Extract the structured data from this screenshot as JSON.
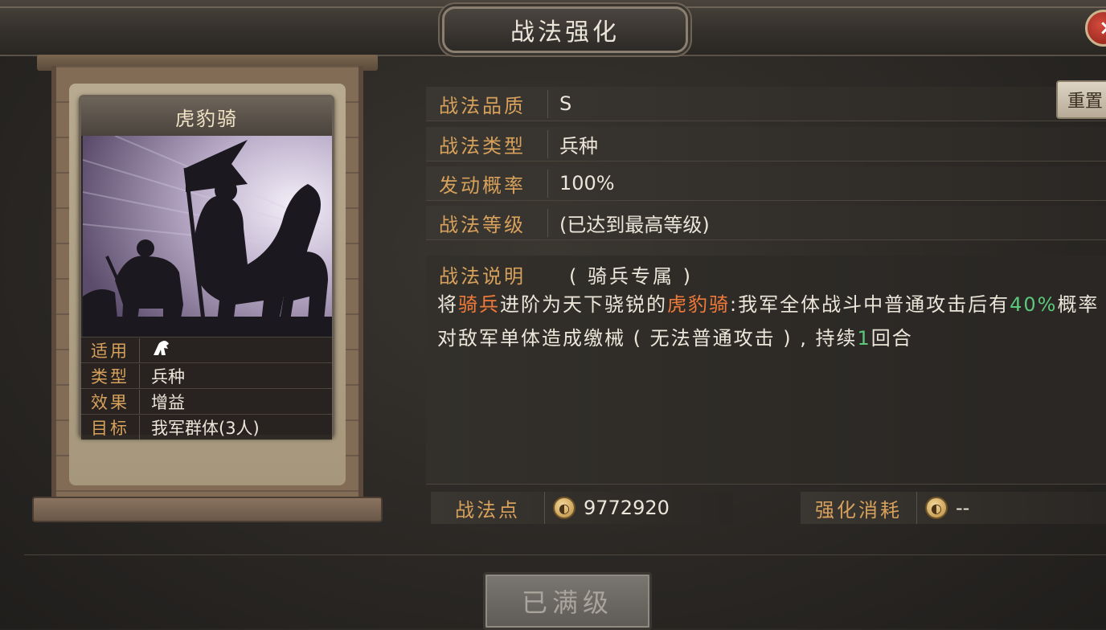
{
  "window": {
    "title": "战法强化",
    "close_icon": "close-icon"
  },
  "card": {
    "name": "虎豹骑",
    "info": [
      {
        "key": "适用",
        "value": "",
        "icon": "cavalry-icon"
      },
      {
        "key": "类型",
        "value": "兵种"
      },
      {
        "key": "效果",
        "value": "增益"
      },
      {
        "key": "目标",
        "value": "我军群体(3人)"
      }
    ]
  },
  "stats": [
    {
      "key": "战法品质",
      "value": "S"
    },
    {
      "key": "战法类型",
      "value": "兵种"
    },
    {
      "key": "发动概率",
      "value": "100%"
    },
    {
      "key": "战法等级",
      "value": "(已达到最高等级)"
    }
  ],
  "reset_label": "重置",
  "description": {
    "title": "战法说明",
    "subtitle": "( 骑兵专属 )",
    "parts": [
      {
        "text": "将",
        "style": "normal"
      },
      {
        "text": "骑兵",
        "style": "orange"
      },
      {
        "text": "进阶为天下骁锐的",
        "style": "normal"
      },
      {
        "text": "虎豹骑",
        "style": "orange"
      },
      {
        "text": ":我军全体战斗中普通攻击后有",
        "style": "normal"
      },
      {
        "text": "40%",
        "style": "green"
      },
      {
        "text": "概率对敌军单体造成缴械 ( 无法普通攻击 ) , 持续",
        "style": "normal"
      },
      {
        "text": "1",
        "style": "green"
      },
      {
        "text": "回合",
        "style": "normal"
      }
    ]
  },
  "points": {
    "label": "战法点",
    "value": "9772920"
  },
  "cost": {
    "label": "强化消耗",
    "value": "--"
  },
  "max_button": "已满级",
  "colors": {
    "key_text": "#d7a15c",
    "orange": "#f07a3a",
    "green": "#5cc87a"
  }
}
